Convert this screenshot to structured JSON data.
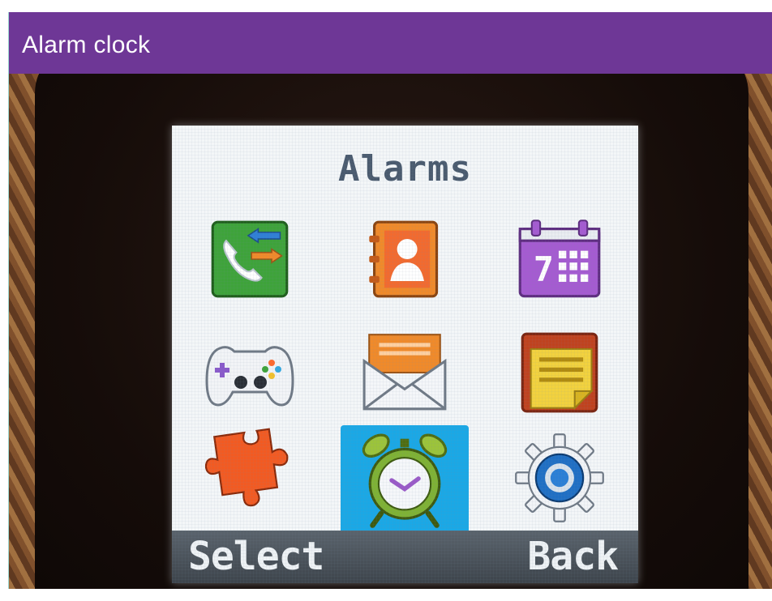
{
  "header": {
    "title": "Alarm clock",
    "color": "#6e3796"
  },
  "screen": {
    "title": "Alarms",
    "selected_index": 7,
    "selection_color": "#1aa8e6",
    "icons": [
      {
        "name": "call-log-icon"
      },
      {
        "name": "contacts-icon"
      },
      {
        "name": "calendar-icon"
      },
      {
        "name": "games-icon"
      },
      {
        "name": "messages-icon"
      },
      {
        "name": "notes-icon"
      },
      {
        "name": "apps-icon"
      },
      {
        "name": "alarm-clock-icon"
      },
      {
        "name": "settings-icon"
      }
    ],
    "calendar_day": "7"
  },
  "softkeys": {
    "left": "Select",
    "right": "Back"
  }
}
